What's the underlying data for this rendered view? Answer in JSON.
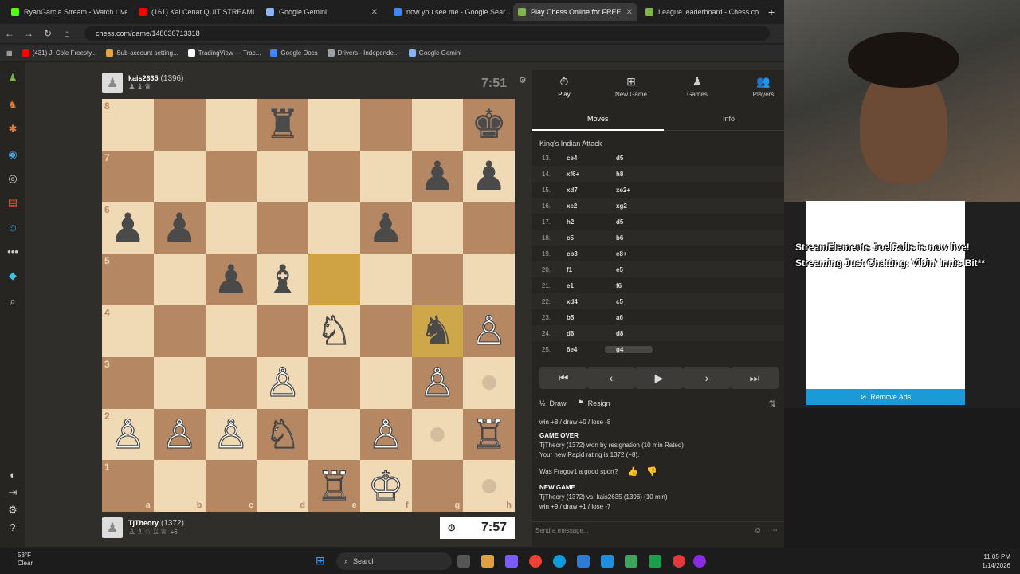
{
  "browser": {
    "tabs": [
      {
        "title": "RyanGarcia Stream - Watch Live",
        "color": "#53fc18"
      },
      {
        "title": "(161) Kai Cenat QUIT STREAMI",
        "color": "#ff0000"
      },
      {
        "title": "Google Gemini",
        "color": "#8ab4f8"
      },
      {
        "title": "now you see me - Google Sear",
        "color": "#4285f4"
      },
      {
        "title": "Play Chess Online for FREE",
        "color": "#81b64c"
      },
      {
        "title": "League leaderboard - Chess.co",
        "color": "#81b64c"
      }
    ],
    "url": "chess.com/game/148030713318",
    "bookmarks": [
      "(431) J. Cole Freesty...",
      "Sub-account setting...",
      "TradingView — Trac...",
      "Google Docs",
      "Drivers - Independe...",
      "Google Gemini"
    ]
  },
  "top_player": {
    "name": "kais2635",
    "rating": "(1396)",
    "clock": "7:51",
    "captured": "♟♝♛"
  },
  "bottom_player": {
    "name": "TjTheory",
    "rating": "(1372)",
    "clock": "7:57",
    "captured": "♙♗♘♖♕",
    "extra": "+6"
  },
  "board": {
    "ranks": [
      "8",
      "7",
      "6",
      "5",
      "4",
      "3",
      "2",
      "1"
    ],
    "files": [
      "a",
      "b",
      "c",
      "d",
      "e",
      "f",
      "g",
      "h"
    ],
    "rows": [
      [
        "",
        "",
        "",
        "♜",
        "",
        "",
        "",
        "♚"
      ],
      [
        "",
        "",
        "",
        "",
        "",
        "",
        "♟",
        "♟"
      ],
      [
        "♟",
        "♟",
        "",
        "",
        "",
        "♟",
        "",
        ""
      ],
      [
        "",
        "",
        "♟",
        "♝",
        "",
        "",
        "",
        ""
      ],
      [
        "",
        "",
        "",
        "",
        "♘",
        "",
        "♞",
        "♙"
      ],
      [
        "",
        "",
        "",
        "♙",
        "",
        "",
        "♙",
        ""
      ],
      [
        "♙",
        "♙",
        "♙",
        "♘",
        "",
        "♙",
        "",
        "♖"
      ],
      [
        "",
        "",
        "",
        "",
        "♖",
        "♔",
        "",
        ""
      ]
    ],
    "colors": [
      [
        "",
        "",
        "",
        "b",
        "",
        "",
        "",
        "b"
      ],
      [
        "",
        "",
        "",
        "",
        "",
        "",
        "b",
        "b"
      ],
      [
        "b",
        "b",
        "",
        "",
        "",
        "b",
        "",
        ""
      ],
      [
        "",
        "",
        "b",
        "b",
        "",
        "",
        "",
        ""
      ],
      [
        "",
        "",
        "",
        "",
        "w",
        "",
        "b",
        "w"
      ],
      [
        "",
        "",
        "",
        "w",
        "",
        "",
        "w",
        ""
      ],
      [
        "w",
        "w",
        "w",
        "w",
        "",
        "w",
        "",
        "w"
      ],
      [
        "",
        "",
        "",
        "",
        "w",
        "w",
        "",
        ""
      ]
    ]
  },
  "panel": {
    "tabs": [
      {
        "icon": "⏱",
        "label": "Play"
      },
      {
        "icon": "⊞",
        "label": "New Game"
      },
      {
        "icon": "♟",
        "label": "Games"
      },
      {
        "icon": "👥",
        "label": "Players"
      }
    ],
    "subtabs": [
      "Moves",
      "Info"
    ],
    "opening": "King's Indian Attack",
    "moves": [
      {
        "n": "13.",
        "w": "ce4",
        "b": "d5"
      },
      {
        "n": "14.",
        "w": "xf6+",
        "b": "h8"
      },
      {
        "n": "15.",
        "w": "xd7",
        "b": "xe2+"
      },
      {
        "n": "16.",
        "w": "xe2",
        "b": "xg2"
      },
      {
        "n": "17.",
        "w": "h2",
        "b": "d5"
      },
      {
        "n": "18.",
        "w": "c5",
        "b": "b6"
      },
      {
        "n": "19.",
        "w": "cb3",
        "b": "e8+"
      },
      {
        "n": "20.",
        "w": "f1",
        "b": "e5"
      },
      {
        "n": "21.",
        "w": "e1",
        "b": "f6"
      },
      {
        "n": "22.",
        "w": "xd4",
        "b": "c5"
      },
      {
        "n": "23.",
        "w": "b5",
        "b": "a6"
      },
      {
        "n": "24.",
        "w": "d6",
        "b": "d8"
      },
      {
        "n": "25.",
        "w": "6e4",
        "b": "g4"
      }
    ],
    "nav": [
      "⏮",
      "‹",
      "▶",
      "›",
      "⏭"
    ],
    "draw": "Draw",
    "resign": "Resign",
    "chat": {
      "line0": "win +8 / draw +0 / lose -8",
      "game_over": "GAME OVER",
      "result": "TjTheory (1372) won by resignation (10 min Rated)",
      "rating": "Your new Rapid rating is 1372 (+8).",
      "sport": "Was Fragov1 a good sport?",
      "new_game": "NEW GAME",
      "match": "TjTheory (1372) vs. kais2635 (1396) (10 min)",
      "odds": "win +9 / draw +1 / lose -7"
    },
    "message_placeholder": "Send a message..."
  },
  "overlay": {
    "alert": "StreamElements JoelRolls is now live! Streaming Just Chatting: Vibin' Innis Bit**",
    "remove_ads": "Remove Ads"
  },
  "taskbar": {
    "weather_temp": "53°F",
    "weather_desc": "Clear",
    "search": "Search",
    "time": "11:05 PM",
    "date": "1/14/2026"
  }
}
